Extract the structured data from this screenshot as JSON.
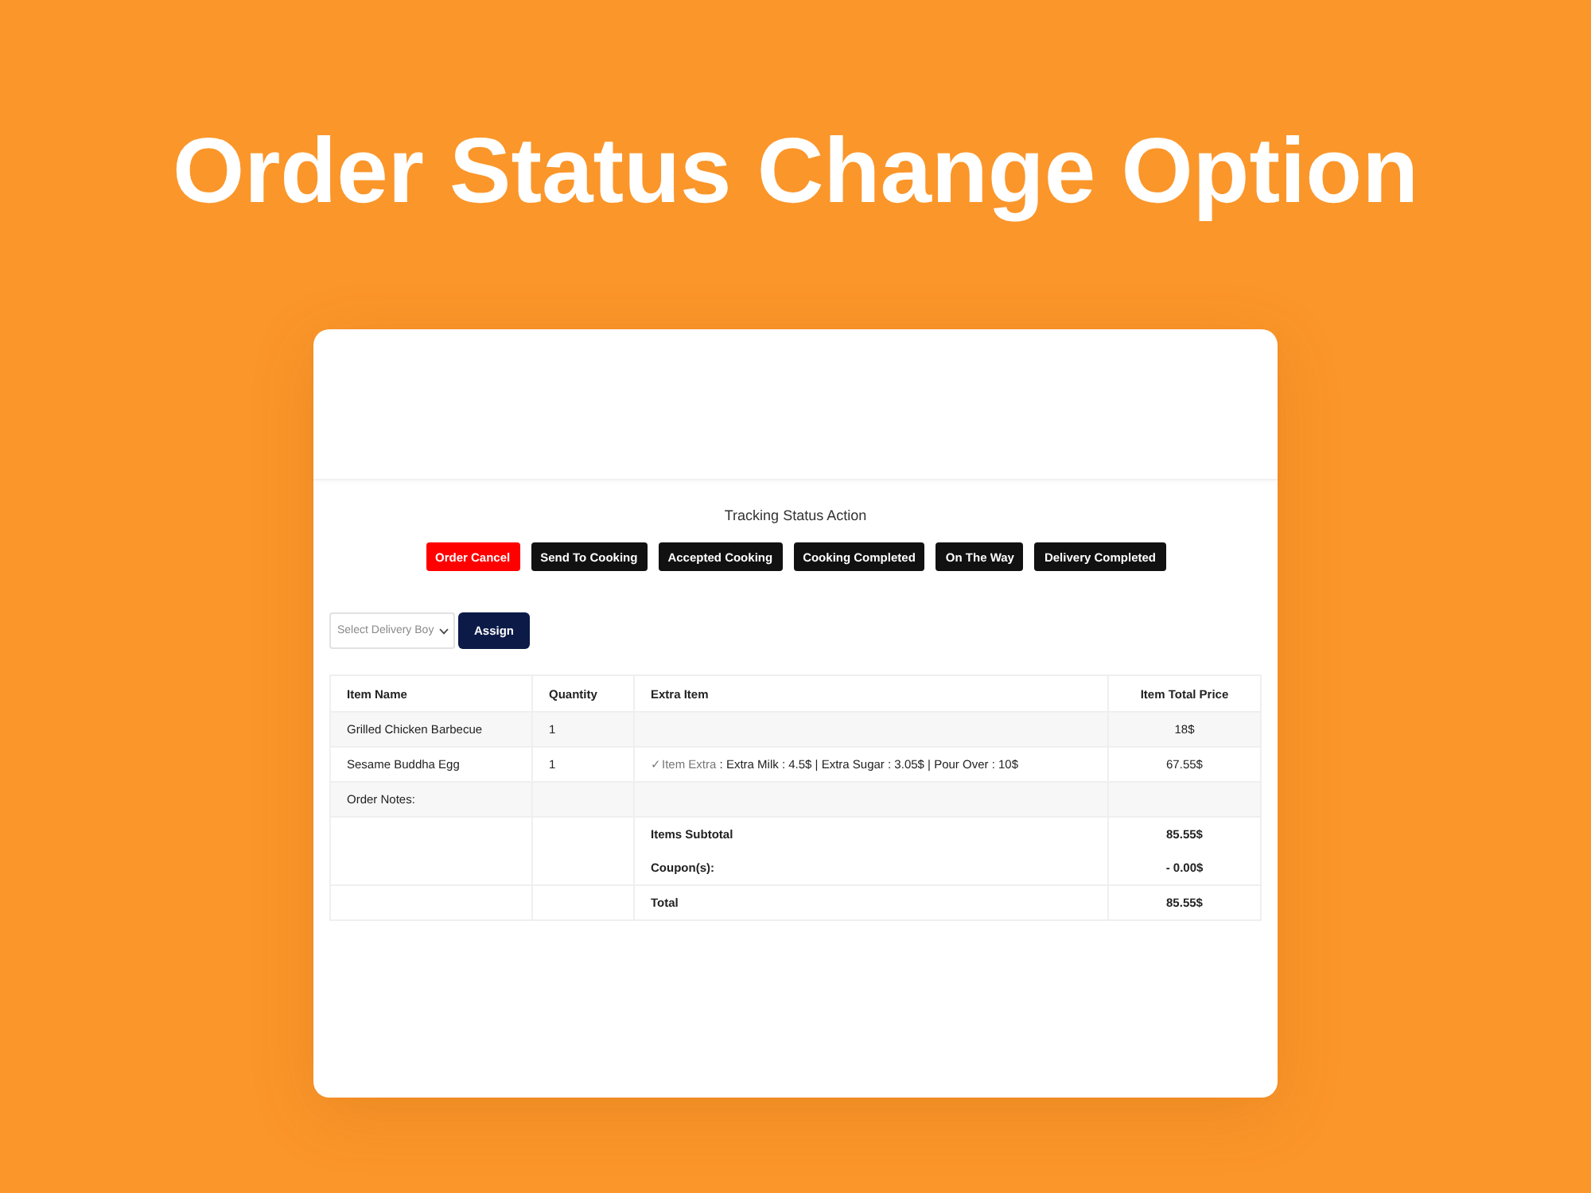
{
  "headline": "Order Status Change Option",
  "tracking": {
    "title": "Tracking Status Action",
    "buttons": [
      {
        "label": "Order Cancel",
        "color": "#ff0000"
      },
      {
        "label": "Send To Cooking",
        "color": "#111111"
      },
      {
        "label": "Accepted Cooking",
        "color": "#111111"
      },
      {
        "label": "Cooking Completed",
        "color": "#111111"
      },
      {
        "label": "On The Way",
        "color": "#111111"
      },
      {
        "label": "Delivery Completed",
        "color": "#111111"
      }
    ]
  },
  "assign": {
    "select": {
      "placeholder": "Select Delivery Boy"
    },
    "button": "Assign"
  },
  "table": {
    "columns": [
      "Item Name",
      "Quantity",
      "Extra Item",
      "Item Total Price"
    ],
    "rows": [
      {
        "item": "Grilled Chicken Barbecue",
        "quantity": "1",
        "price": "18$"
      },
      {
        "item": "Sesame Buddha Egg",
        "quantity": "1",
        "extra": {
          "label": "✓Item Extra",
          "details": ": Extra Milk : 4.5$ | Extra Sugar : 3.05$ | Pour Over : 10$"
        },
        "price": "67.55$"
      }
    ],
    "notes": {
      "label": "Order Notes:"
    },
    "summary": [
      {
        "label": "Items Subtotal",
        "value": "85.55$"
      },
      {
        "label": "Coupon(s):",
        "value": "- 0.00$"
      }
    ],
    "total": {
      "label": "Total",
      "value": "85.55$"
    }
  }
}
